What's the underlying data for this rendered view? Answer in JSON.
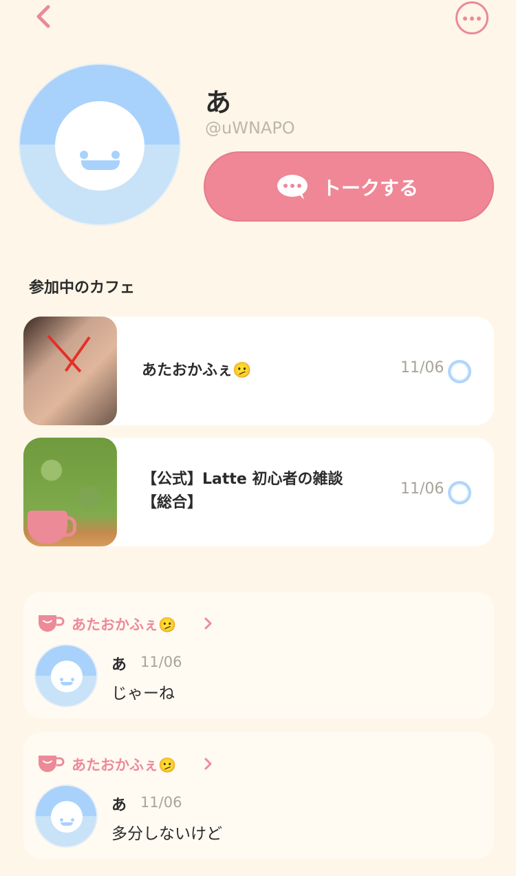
{
  "profile": {
    "name": "あ",
    "user_id": "@uWNAPO",
    "talk_button_label": "トークする"
  },
  "cafes_section": {
    "title": "参加中のカフェ",
    "items": [
      {
        "title_line1": "あたおかふぇ🫤",
        "title_line2": "",
        "date": "11/06"
      },
      {
        "title_line1": "【公式】Latte 初心者の雑談",
        "title_line2": "【総合】",
        "date": "11/06"
      }
    ]
  },
  "posts": [
    {
      "cafe_name": "あたおかふぇ🫤",
      "author": "あ",
      "date": "11/06",
      "message": "じゃーね"
    },
    {
      "cafe_name": "あたおかふぇ🫤",
      "author": "あ",
      "date": "11/06",
      "message": "多分しないけど"
    }
  ],
  "colors": {
    "background": "#FEF6E8",
    "accent_pink": "#EF8797",
    "avatar_blue": "#A8D2FB"
  },
  "icons": {
    "back": "chevron-left-icon",
    "more": "more-icon",
    "chat": "chat-bubble-icon",
    "cup": "cup-icon"
  }
}
